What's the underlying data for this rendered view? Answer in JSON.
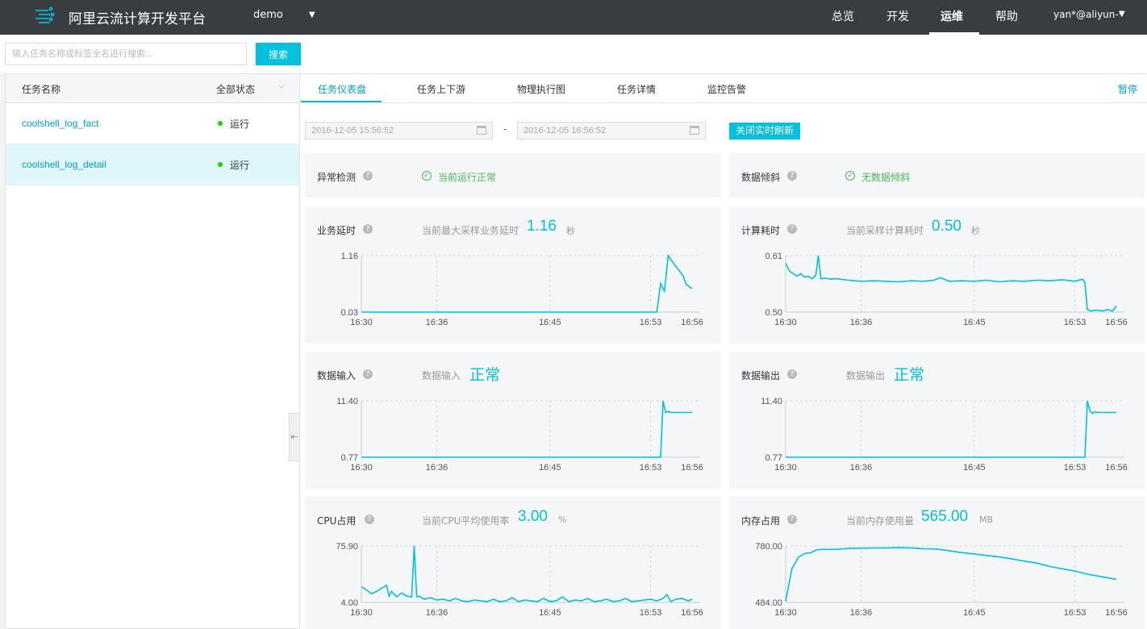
{
  "topbar": {
    "title": "阿里云流计算开发平台",
    "project": "demo",
    "nav": [
      "总览",
      "开发",
      "运维",
      "帮助"
    ],
    "active_nav": "运维",
    "user": "yan*@aliyun-*"
  },
  "search": {
    "placeholder": "输入任务名称或标签全名进行搜索...",
    "button": "搜索"
  },
  "task_list": {
    "header_name": "任务名称",
    "header_status": "全部状态",
    "tasks": [
      {
        "name": "coolshell_log_fact",
        "status": "运行"
      },
      {
        "name": "coolshell_log_detail",
        "status": "运行",
        "selected": true
      }
    ]
  },
  "tabs": [
    "任务仪表盘",
    "任务上下游",
    "物理执行图",
    "任务详情",
    "监控告警"
  ],
  "active_tab": "任务仪表盘",
  "pause_label": "暂停",
  "date_range": {
    "start": "2016-12-05 15:56:52",
    "separator": "-",
    "end": "2016-12-05 16:56:52"
  },
  "refresh_button": "关闭实时刷新",
  "anomaly": {
    "title": "异常检测",
    "status": "当前运行正常"
  },
  "skew": {
    "title": "数据倾斜",
    "status": "无数据倾斜"
  },
  "latency": {
    "title": "业务延时",
    "label": "当前最大采样业务延时",
    "value": "1.16",
    "unit": "秒"
  },
  "compute": {
    "title": "计算耗时",
    "label": "当前采样计算耗时",
    "value": "0.50",
    "unit": "秒"
  },
  "input": {
    "title": "数据输入",
    "label": "数据输入",
    "status": "正常"
  },
  "output": {
    "title": "数据输出",
    "label": "数据输出",
    "status": "正常"
  },
  "cpu": {
    "title": "CPU占用",
    "label": "当前CPU平均使用率",
    "value": "3.00",
    "unit": "%"
  },
  "memory": {
    "title": "内存占用",
    "label": "当前内存使用量",
    "value": "565.00",
    "unit": "MB"
  },
  "chart_data": [
    {
      "type": "line",
      "id": "latency",
      "ylim": [
        0.03,
        1.16
      ],
      "yticks": [
        "1.16",
        "0.03"
      ],
      "xticks": [
        "16:30",
        "16:36",
        "16:45",
        "16:53",
        "16:56"
      ],
      "x": [
        0,
        23.5,
        23.8,
        24.1,
        24.4,
        24.7,
        25.0,
        25.3,
        25.6,
        25.8,
        26.0,
        26.3
      ],
      "values": [
        0.03,
        0.03,
        0.6,
        0.45,
        1.16,
        1.05,
        0.95,
        0.85,
        0.75,
        0.6,
        0.55,
        0.5
      ]
    },
    {
      "type": "line",
      "id": "compute",
      "ylim": [
        0.5,
        0.61
      ],
      "yticks": [
        "0.61",
        "0.50"
      ],
      "xticks": [
        "16:30",
        "16:36",
        "16:45",
        "16:53",
        "16:56"
      ],
      "x": [
        0,
        0.3,
        0.6,
        0.9,
        1.2,
        1.5,
        1.8,
        2.1,
        2.4,
        2.6,
        2.8,
        3.2,
        3.6,
        4.0,
        5,
        6,
        7,
        8,
        9,
        10,
        11,
        11.8,
        12.3,
        13,
        14,
        15,
        16,
        17,
        18,
        19,
        20,
        21,
        22,
        23,
        23.6,
        23.8,
        24.0,
        24.3,
        24.7,
        25.2,
        25.6,
        26.0,
        26.3
      ],
      "values": [
        0.595,
        0.58,
        0.575,
        0.57,
        0.575,
        0.568,
        0.57,
        0.565,
        0.572,
        0.61,
        0.565,
        0.566,
        0.564,
        0.565,
        0.562,
        0.56,
        0.561,
        0.56,
        0.559,
        0.561,
        0.56,
        0.562,
        0.567,
        0.56,
        0.561,
        0.56,
        0.562,
        0.559,
        0.561,
        0.56,
        0.562,
        0.561,
        0.563,
        0.56,
        0.564,
        0.558,
        0.505,
        0.502,
        0.504,
        0.502,
        0.505,
        0.502,
        0.512
      ]
    },
    {
      "type": "line",
      "id": "input",
      "ylim": [
        0.77,
        11.4
      ],
      "yticks": [
        "11.40",
        "0.77"
      ],
      "xticks": [
        "16:30",
        "16:36",
        "16:45",
        "16:53",
        "16:56"
      ],
      "x": [
        0,
        23.6,
        23.8,
        24.0,
        24.2,
        24.4,
        24.6,
        26.3
      ],
      "values": [
        0.77,
        0.77,
        0.77,
        11.4,
        9.2,
        9.4,
        9.2,
        9.2
      ]
    },
    {
      "type": "line",
      "id": "output",
      "ylim": [
        0.77,
        11.4
      ],
      "yticks": [
        "11.40",
        "0.77"
      ],
      "xticks": [
        "16:30",
        "16:36",
        "16:45",
        "16:53",
        "16:56"
      ],
      "x": [
        0,
        23.6,
        23.8,
        24.0,
        24.2,
        24.4,
        24.6,
        24.8,
        26.3
      ],
      "values": [
        0.77,
        0.77,
        0.77,
        11.4,
        9.5,
        9.0,
        9.3,
        9.2,
        9.2
      ]
    },
    {
      "type": "line",
      "id": "cpu",
      "ylim": [
        4.0,
        75.9
      ],
      "yticks": [
        "75.90",
        "4.00"
      ],
      "xticks": [
        "16:30",
        "16:36",
        "16:45",
        "16:53",
        "16:56"
      ],
      "x": [
        0,
        0.4,
        0.8,
        1.2,
        1.6,
        2.0,
        2.2,
        2.4,
        2.8,
        3.2,
        3.6,
        4.0,
        4.2,
        4.4,
        4.6,
        5,
        5.5,
        6,
        6.5,
        7,
        7.5,
        8,
        8.5,
        9,
        9.5,
        10,
        10.5,
        11,
        11.5,
        12,
        12.5,
        13,
        13.5,
        14,
        14.5,
        15,
        15.5,
        16,
        16.5,
        17,
        17.5,
        18,
        18.5,
        19,
        19.5,
        20,
        20.5,
        21,
        21.5,
        22,
        22.5,
        23,
        23.5,
        24,
        24.3,
        24.6,
        25,
        25.5,
        26,
        26.3
      ],
      "values": [
        24,
        20,
        15,
        18,
        22,
        26,
        12,
        18,
        11,
        16,
        12,
        11,
        76,
        11,
        12,
        8,
        10,
        7,
        8,
        6,
        9,
        6,
        5,
        7,
        6,
        5,
        8,
        5,
        6,
        10,
        5,
        7,
        6,
        5,
        9,
        5,
        6,
        11,
        5,
        7,
        6,
        9,
        5,
        6,
        8,
        5,
        6,
        9,
        5,
        6,
        7,
        8,
        6,
        9,
        14,
        5,
        8,
        9,
        6,
        8
      ]
    },
    {
      "type": "line",
      "id": "memory",
      "ylim": [
        484.0,
        780.0
      ],
      "yticks": [
        "780.00",
        "484.00"
      ],
      "xticks": [
        "16:30",
        "16:36",
        "16:45",
        "16:53",
        "16:56"
      ],
      "x": [
        0,
        0.5,
        1.0,
        1.5,
        2.0,
        2.5,
        3.0,
        4.0,
        5.0,
        6.0,
        7.0,
        8.0,
        9.0,
        10.0,
        11.0,
        12.0,
        13.0,
        14.0,
        15.0,
        16.0,
        17.0,
        18.0,
        19.0,
        20.0,
        21.0,
        22.0,
        23.0,
        24.0,
        25.0,
        26.3
      ],
      "values": [
        490,
        660,
        720,
        740,
        745,
        760,
        762,
        762,
        767,
        768,
        769,
        770,
        771,
        770,
        765,
        764,
        755,
        745,
        738,
        730,
        722,
        712,
        700,
        690,
        672,
        660,
        648,
        632,
        620,
        605
      ]
    }
  ]
}
